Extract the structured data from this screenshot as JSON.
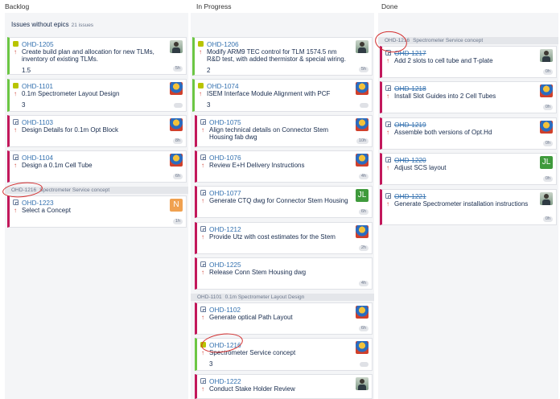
{
  "columns": [
    {
      "label": "Backlog"
    },
    {
      "label": "In Progress"
    },
    {
      "label": "Done"
    }
  ],
  "swimlane_no_epics": {
    "label": "Issues without epics",
    "count": "21 issues"
  },
  "lanes": {
    "ohd1216": {
      "key": "OHD-1216",
      "title": "Spectrometer Service concept"
    },
    "ohd1101": {
      "key": "OHD-1101",
      "title": "0.1m Spectrometer Layout Design"
    }
  },
  "backlog_cards": [
    {
      "key": "OHD-1205",
      "summary": "Create build plan and allocation for new TLMs, inventory of existing TLMs.",
      "points": "1.5",
      "time": "5h"
    },
    {
      "key": "OHD-1101",
      "summary": "0.1m Spectrometer Layout Design",
      "points": "3"
    },
    {
      "key": "OHD-1103",
      "summary": "Design Details for 0.1m Opt Block",
      "time": "8h"
    },
    {
      "key": "OHD-1104",
      "summary": "Design a 0.1m Cell Tube",
      "time": "6h"
    },
    {
      "key": "OHD-1223",
      "summary": "Select a Concept",
      "time": "1h",
      "avatar": "N"
    }
  ],
  "progress_cards": [
    {
      "key": "OHD-1206",
      "summary": "Modify ARM9 TEC control for TLM 1574.5 nm R&D test, with added thermistor & special wiring.",
      "points": "2",
      "time": "5h"
    },
    {
      "key": "OHD-1074",
      "summary": "ISEM Interface Module Alignment with PCF",
      "points": "3"
    },
    {
      "key": "OHD-1075",
      "summary": "Align technical details on Connector Stem Housing fab dwg",
      "time": "10h"
    },
    {
      "key": "OHD-1076",
      "summary": "Review E+H Delivery Instructions",
      "time": "4h"
    },
    {
      "key": "OHD-1077",
      "summary": "Generate CTQ dwg for Connector Stem Housing",
      "time": "6h",
      "avatar": "JL"
    },
    {
      "key": "OHD-1212",
      "summary": "Provide Utz with cost estimates for the Stem",
      "time": "2h"
    },
    {
      "key": "OHD-1225",
      "summary": "Release Conn Stem Housing dwg",
      "time": "4h"
    },
    {
      "key": "OHD-1102",
      "summary": "Generate optical Path Layout",
      "time": "6h"
    },
    {
      "key": "OHD-1216",
      "summary": "Spectrometer Service concept",
      "points": "3"
    },
    {
      "key": "OHD-1222",
      "summary": "Conduct Stake Holder Review"
    }
  ],
  "done_cards": [
    {
      "key": "OHD-1217",
      "summary": "Add 2 slots to cell tube and T-plate",
      "time": "0h"
    },
    {
      "key": "OHD-1218",
      "summary": "Install Slot Guides into 2 Cell Tubes",
      "time": "0h"
    },
    {
      "key": "OHD-1219",
      "summary": "Assemble both versions of Opt.Hd",
      "time": "0h"
    },
    {
      "key": "OHD-1220",
      "summary": "Adjust SCS layout",
      "time": "0h",
      "avatar": "JL"
    },
    {
      "key": "OHD-1221",
      "summary": "Generate Spectrometer installation instructions",
      "time": "0h"
    }
  ]
}
